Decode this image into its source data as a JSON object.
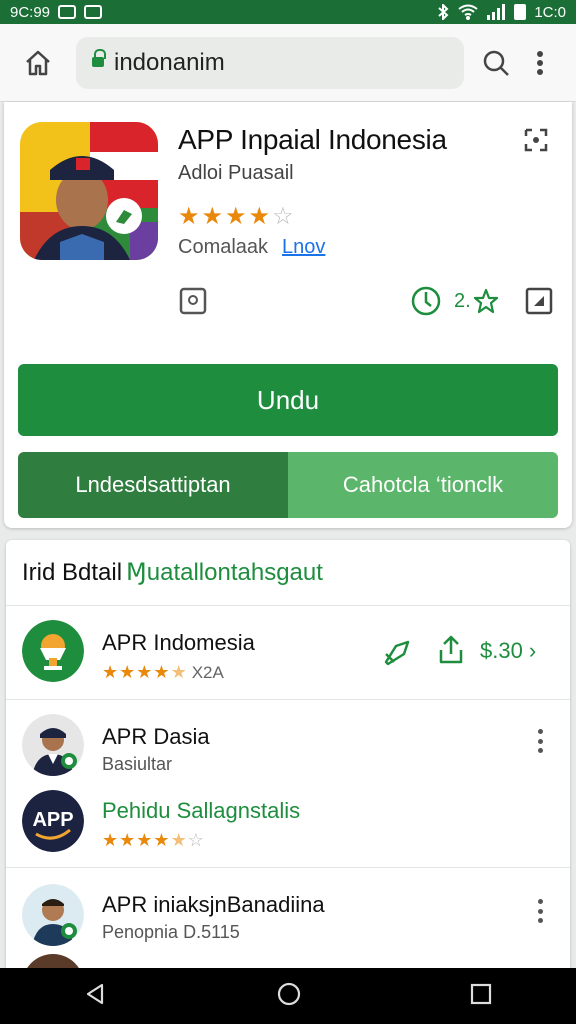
{
  "status_bar": {
    "time_left": "9C:99",
    "time_right": "1C:0"
  },
  "browser": {
    "url": "indonanim"
  },
  "app": {
    "title": "APP Inpaial Indonesia",
    "developer": "Adloi Puasail",
    "rating_stars": 4,
    "meta_text": "Comalaak",
    "meta_link": "Lnov",
    "rating_short": "2.",
    "install_label": "Undu",
    "secondary_left_label": "Lndesdsattiptan",
    "secondary_right_label": "Cahotcla ‘tionclk"
  },
  "list": {
    "heading_dark": "Irid Bdtail",
    "heading_green": "Ɱuatallontahsgaut",
    "items": [
      {
        "title": "APR Indomesia",
        "stars": 4.5,
        "count": "X2A",
        "price": "$.30 ›"
      },
      {
        "title": "APR Dasia",
        "subtitle": "Basiultar"
      },
      {
        "title": "Pehidu Sallagnstalis",
        "stars": 4.5
      },
      {
        "title": "APR iniaksjnBanadiina",
        "subtitle": "Penopnia D.5115"
      }
    ]
  },
  "colors": {
    "accent": "#1e8e3e",
    "status_bar": "#1b6f36",
    "star": "#e8890c"
  }
}
